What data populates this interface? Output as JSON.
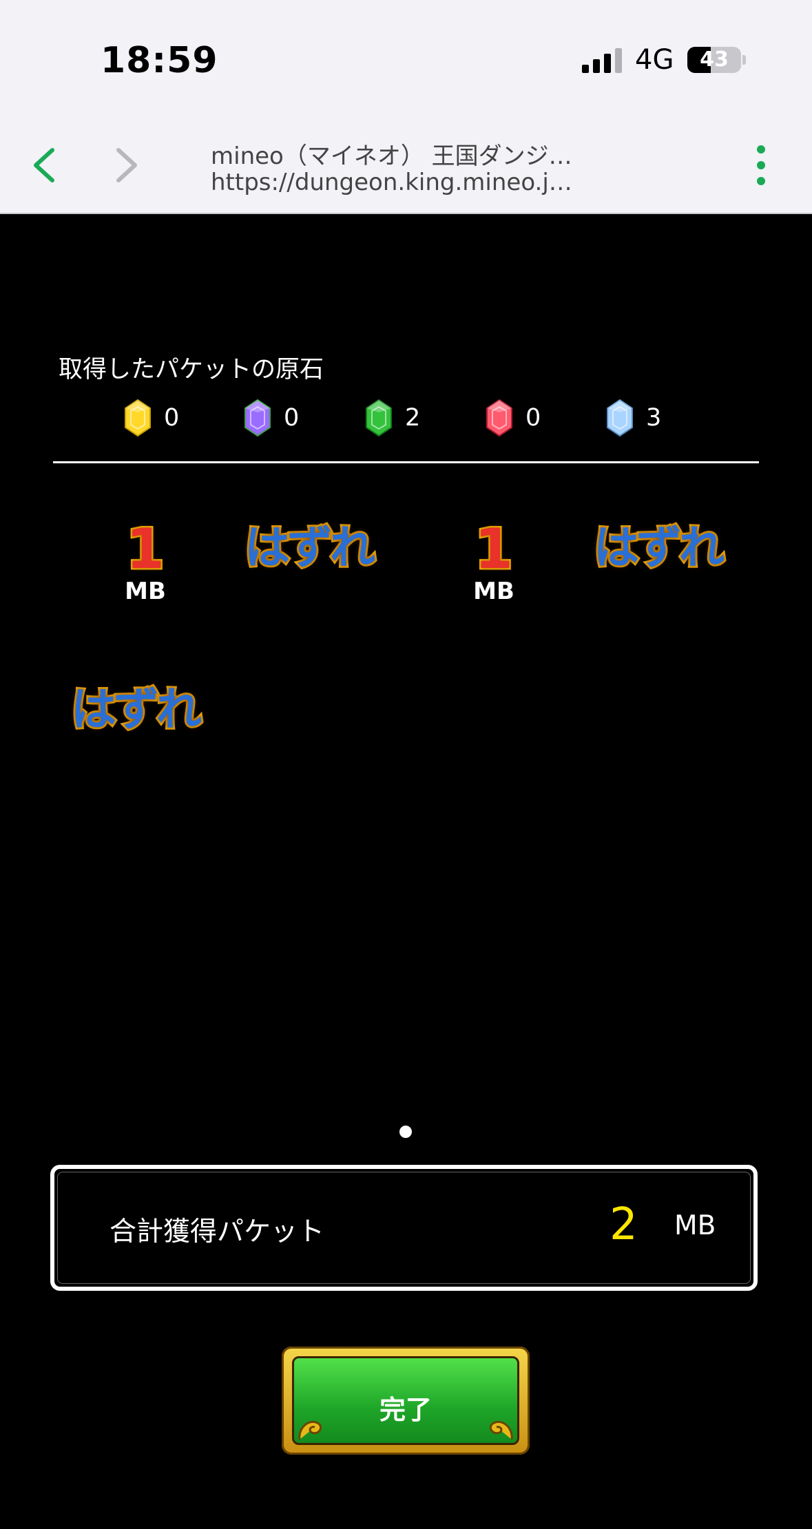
{
  "status_bar": {
    "time": "18:59",
    "network": "4G",
    "battery_level": "43",
    "battery_fraction": 0.43
  },
  "browser": {
    "title": "mineo（マイネオ） 王国ダンジ…",
    "url": "https://dungeon.king.mineo.j…"
  },
  "gems": {
    "title": "取得したパケットの原石",
    "items": [
      {
        "color": "yellow",
        "count": "0",
        "fill": "#ffd82a",
        "shade": "#c9a000"
      },
      {
        "color": "purple",
        "count": "0",
        "fill": "#9a6cff",
        "shade": "#3fa04a"
      },
      {
        "color": "green",
        "count": "2",
        "fill": "#33c23b",
        "shade": "#137a1a"
      },
      {
        "color": "red",
        "count": "0",
        "fill": "#ff5a6e",
        "shade": "#b11a2e"
      },
      {
        "color": "light-blue",
        "count": "3",
        "fill": "#a8d4ff",
        "shade": "#5a8fc4"
      }
    ]
  },
  "prizes": [
    {
      "type": "mb",
      "value": "1",
      "unit": "MB"
    },
    {
      "type": "miss",
      "text": "はずれ"
    },
    {
      "type": "mb",
      "value": "1",
      "unit": "MB"
    },
    {
      "type": "miss",
      "text": "はずれ"
    },
    {
      "type": "miss",
      "text": "はずれ"
    }
  ],
  "total": {
    "label": "合計獲得パケット",
    "value": "2",
    "unit": "MB"
  },
  "done_button": {
    "label": "完了"
  },
  "colors": {
    "background": "#000000",
    "accent_value": "#ffe600",
    "browser_nav": "#1aaa55"
  }
}
